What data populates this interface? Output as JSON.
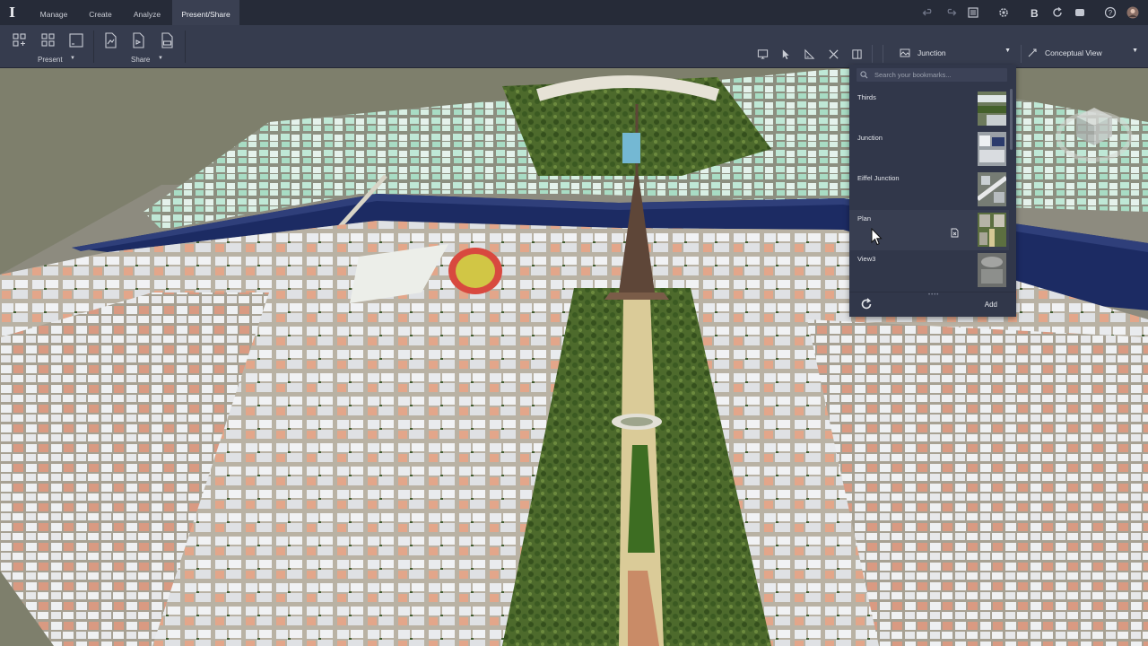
{
  "app": {
    "logo": "I"
  },
  "menu": {
    "tabs": [
      {
        "label": "Manage"
      },
      {
        "label": "Create"
      },
      {
        "label": "Analyze"
      },
      {
        "label": "Present/Share"
      }
    ],
    "active_tab": "Present/Share",
    "right_icons": [
      "undo-icon",
      "redo-icon",
      "layers-icon",
      "settings-icon",
      "bold-b-icon",
      "sync-icon",
      "cloud-icon",
      "help-icon",
      "user-avatar"
    ]
  },
  "ribbon": {
    "present_group": {
      "label": "Present"
    },
    "share_group": {
      "label": "Share"
    },
    "view_tools": [
      "viewport-settings-icon",
      "select-icon",
      "measure-icon",
      "tools-icon",
      "panel-icon"
    ],
    "bookmark_dropdown": {
      "value": "Junction"
    },
    "style_dropdown": {
      "value": "Conceptual View"
    }
  },
  "bookmarks": {
    "search_placeholder": "Search your bookmarks...",
    "items": [
      {
        "label": "Thirds"
      },
      {
        "label": "Junction"
      },
      {
        "label": "Eiffel Junction"
      },
      {
        "label": "Plan"
      },
      {
        "label": "View3"
      }
    ],
    "hovered_item": "Plan",
    "add_label": "Add"
  },
  "colors": {
    "menubar": "#262b38",
    "ribbon": "#363c4e",
    "active_tab": "#3a4052",
    "panel": "#31374a",
    "river": "#1c2b63",
    "ground": "#7e7f6c"
  }
}
